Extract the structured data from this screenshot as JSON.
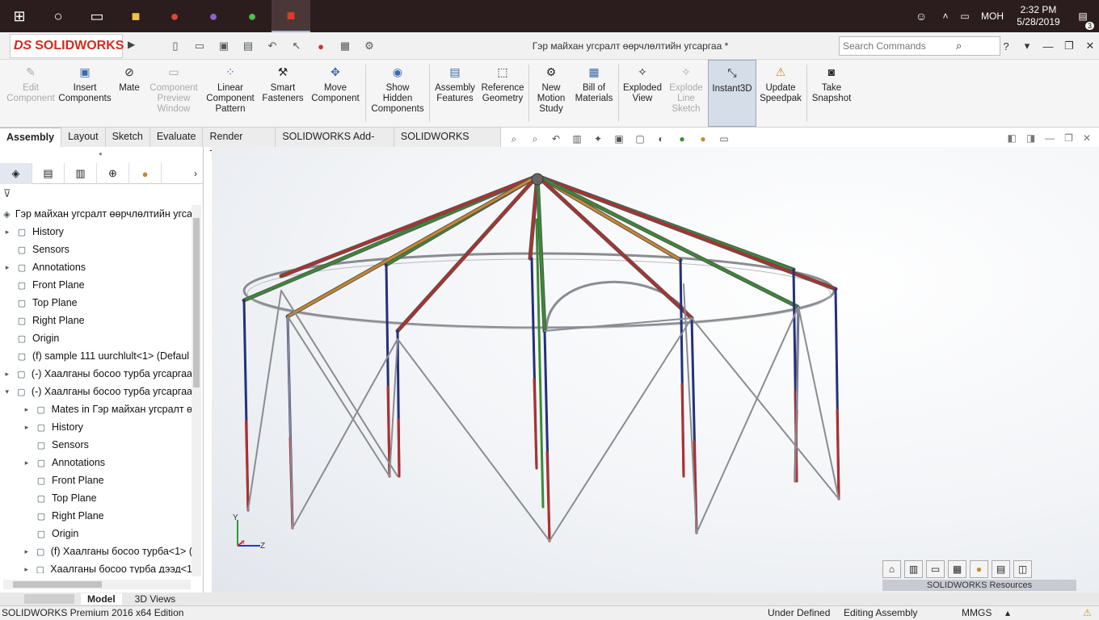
{
  "taskbar": {
    "language": "МОН",
    "time": "2:32 PM",
    "date": "5/28/2019",
    "notifications": "3",
    "apps": [
      "start-icon",
      "search-icon",
      "task-view-icon",
      "file-explorer-icon",
      "chrome-icon",
      "viber-icon",
      "wechat-icon",
      "solidworks-icon"
    ]
  },
  "titlebar": {
    "logo_text": "SOLIDWORKS",
    "doc_title": "Гэр майхан угсралт өөрчлөлтийн угсаргаа *",
    "search_placeholder": "Search Commands"
  },
  "ribbon": {
    "edit_component": "Edit Component",
    "insert_components": "Insert Components",
    "mate": "Mate",
    "component_preview": "Component Preview Window",
    "linear_pattern": "Linear Component Pattern",
    "smart_fasteners": "Smart Fasteners",
    "move_component": "Move Component",
    "show_hidden": "Show Hidden Components",
    "assembly_features": "Assembly Features",
    "reference_geometry": "Reference Geometry",
    "new_motion": "New Motion Study",
    "bom": "Bill of Materials",
    "exploded_view": "Exploded View",
    "explode_line": "Explode Line Sketch",
    "instant3d": "Instant3D",
    "update_speedpak": "Update Speedpak",
    "take_snapshot": "Take Snapshot"
  },
  "tabs": [
    "Assembly",
    "Layout",
    "Sketch",
    "Evaluate",
    "Render Tools",
    "SOLIDWORKS Add-Ins",
    "SOLIDWORKS MBD"
  ],
  "tree": {
    "root": "Гэр майхан угсралт өөрчлөлтийн угса",
    "items": [
      {
        "label": "History",
        "expand": "▸"
      },
      {
        "label": "Sensors",
        "expand": ""
      },
      {
        "label": "Annotations",
        "expand": "▸"
      },
      {
        "label": "Front Plane",
        "expand": ""
      },
      {
        "label": "Top Plane",
        "expand": ""
      },
      {
        "label": "Right Plane",
        "expand": ""
      },
      {
        "label": "Origin",
        "expand": ""
      },
      {
        "label": "(f) sample 111 uurchlult<1> (Defaul",
        "expand": ""
      },
      {
        "label": "(-) Хаалганы босоо турба угсаргаа",
        "expand": "▸"
      },
      {
        "label": "(-) Хаалганы босоо турба угсаргаа",
        "expand": "▾"
      }
    ],
    "sub_items": [
      {
        "label": "Mates in Гэр майхан угсралт ө",
        "expand": "▸"
      },
      {
        "label": "History",
        "expand": "▸"
      },
      {
        "label": "Sensors",
        "expand": ""
      },
      {
        "label": "Annotations",
        "expand": "▸"
      },
      {
        "label": "Front Plane",
        "expand": ""
      },
      {
        "label": "Top Plane",
        "expand": ""
      },
      {
        "label": "Right Plane",
        "expand": ""
      },
      {
        "label": "Origin",
        "expand": ""
      },
      {
        "label": "(f) Хаалганы босоо турба<1> (",
        "expand": "▸"
      },
      {
        "label": "Хаалганы босоо турба дээд<1",
        "expand": "▸"
      }
    ]
  },
  "bottom_tabs": [
    "Model",
    "3D Views"
  ],
  "status": {
    "edition": "SOLIDWORKS Premium 2016 x64 Edition",
    "definition": "Under Defined",
    "editing": "Editing Assembly",
    "units": "MMGS"
  },
  "resources": {
    "label": "SOLIDWORKS Resources"
  },
  "axes": {
    "y": "Y",
    "z": "Z",
    "x": "X"
  },
  "colors": {
    "red_pole": "#b0302c",
    "green_pole": "#3a8a34",
    "orange_pole": "#c8872e",
    "blue_post": "#23307a",
    "steel": "#8a8c92"
  }
}
